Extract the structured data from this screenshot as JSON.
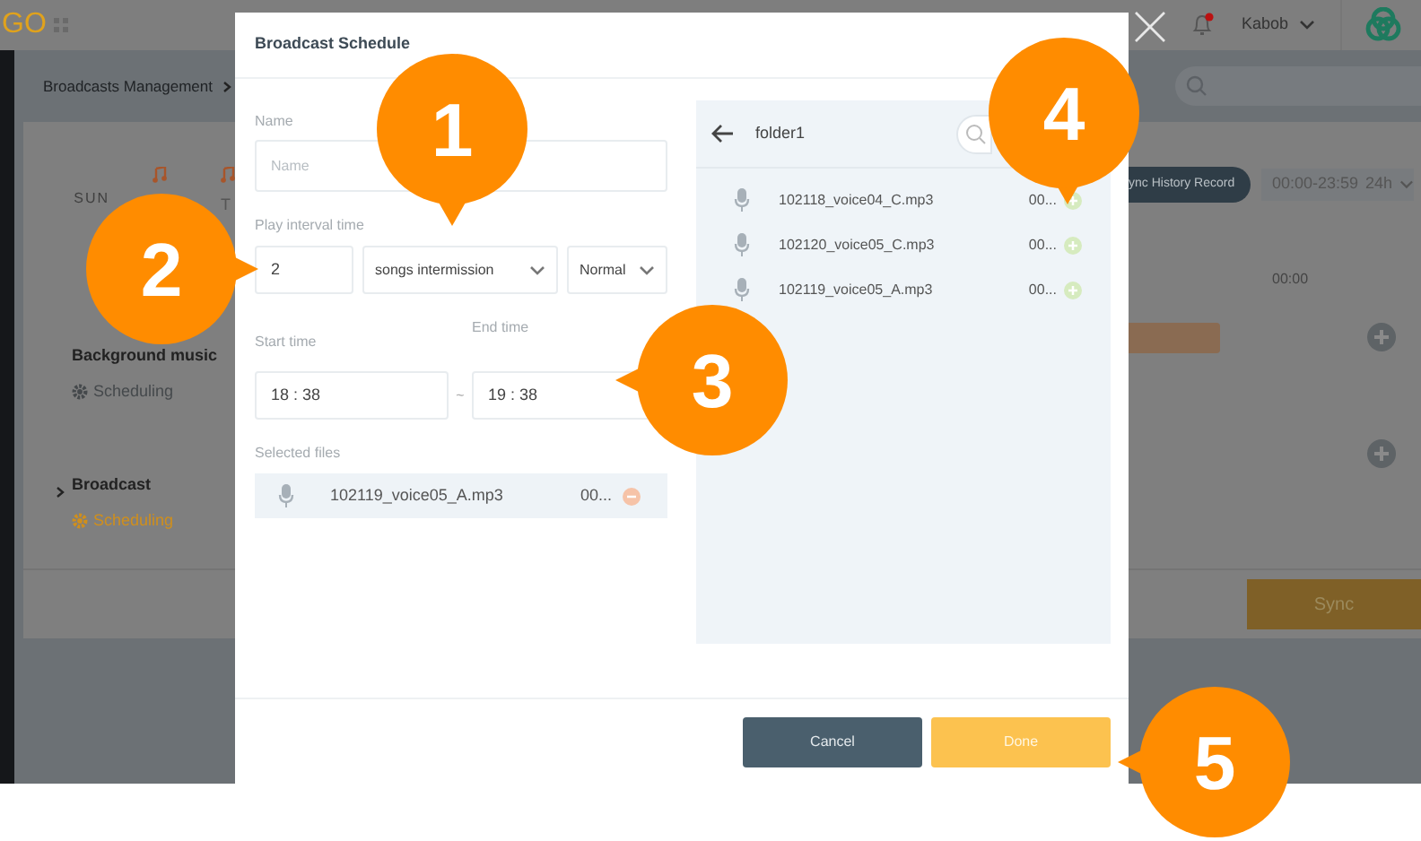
{
  "app": {
    "logo": "GO",
    "user": "Kabob",
    "breadcrumb": "Broadcasts Management",
    "days": [
      "SUN",
      "T"
    ],
    "rows": [
      {
        "title": "Background music",
        "status": "Scheduling",
        "highlighted": false,
        "expandable": false
      },
      {
        "title": "Broadcast",
        "status": "Scheduling",
        "highlighted": true,
        "expandable": true
      }
    ],
    "history_button": "ync History Record",
    "time_range": "00:00-23:59",
    "period": "24h",
    "tick": "00:00",
    "sync_button": "Sync"
  },
  "dialog": {
    "title": "Broadcast Schedule",
    "name": {
      "label": "Name",
      "placeholder": "Name"
    },
    "interval": {
      "label": "Play interval time",
      "count": "2",
      "mode": "songs intermission",
      "speed": "Normal"
    },
    "start": {
      "label": "Start time",
      "value": "18 : 38"
    },
    "end": {
      "label": "End time",
      "value": "19 : 38"
    },
    "separator": "~",
    "selected": {
      "label": "Selected files",
      "files": [
        {
          "name": "102119_voice05_A.mp3",
          "duration": "00..."
        }
      ]
    },
    "browser": {
      "folder": "folder1",
      "files": [
        {
          "name": "102118_voice04_C.mp3",
          "duration": "00..."
        },
        {
          "name": "102120_voice05_C.mp3",
          "duration": "00..."
        },
        {
          "name": "102119_voice05_A.mp3",
          "duration": "00..."
        }
      ]
    },
    "buttons": [
      {
        "label": "Cancel",
        "kind": "secondary"
      },
      {
        "label": "Done",
        "kind": "primary"
      }
    ]
  },
  "callouts": [
    "1",
    "2",
    "3",
    "4",
    "5"
  ]
}
